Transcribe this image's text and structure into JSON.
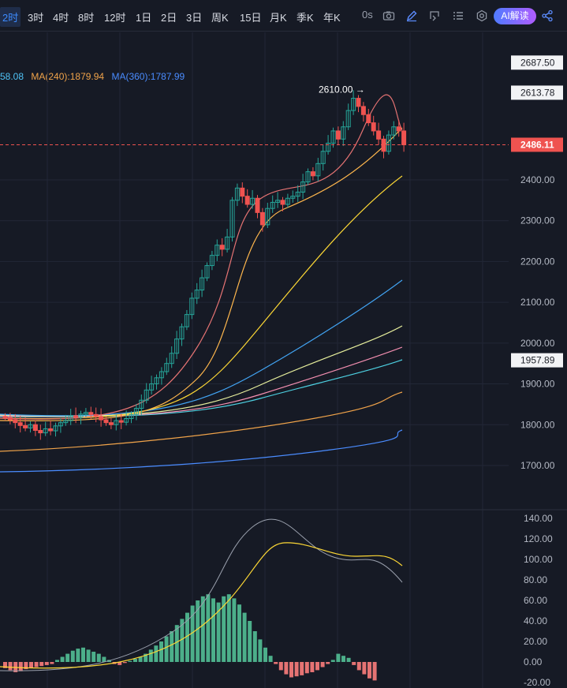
{
  "toolbar": {
    "timeframes": [
      "2时",
      "3时",
      "4时",
      "8时",
      "12时",
      "1日",
      "2日",
      "3日",
      "周K",
      "15日",
      "月K",
      "季K",
      "年K"
    ],
    "active_timeframe": "2时",
    "countdown": "0s",
    "ai_button": "AI解读",
    "icons": [
      "camera-icon",
      "pencil-icon",
      "replay-icon",
      "indicator-list-icon",
      "settings-icon",
      "share-icon"
    ]
  },
  "legend": {
    "ma_partial": "58.08",
    "ma240": "MA(240):1879.94",
    "ma360": "MA(360):1787.99",
    "colors": {
      "partial": "#4fc3f7",
      "ma240": "#f0a34a",
      "ma360": "#4a8cff"
    }
  },
  "price_axis": {
    "labels": [
      "2400.00",
      "2300.00",
      "2200.00",
      "2100.00",
      "2000.00",
      "1900.00",
      "1800.00",
      "1700.00"
    ],
    "boxes": [
      {
        "text": "2687.50",
        "value": 2687.5,
        "style": "light"
      },
      {
        "text": "2613.78",
        "value": 2613.78,
        "style": "light"
      },
      {
        "text": "2486.11",
        "value": 2486.11,
        "style": "current"
      },
      {
        "text": "1957.89",
        "value": 1957.89,
        "style": "light"
      }
    ],
    "current_price": 2486.11
  },
  "annotations": {
    "high_label": "2610.00 →",
    "high_value": 2610
  },
  "indicator_axis": {
    "labels": [
      "140.00",
      "120.00",
      "100.00",
      "80.00",
      "60.00",
      "40.00",
      "20.00",
      "0.00",
      "-20.00"
    ]
  },
  "colors": {
    "up": "#26a69a",
    "down": "#ef5350",
    "bg": "#161a25",
    "grid": "#222736"
  }
}
